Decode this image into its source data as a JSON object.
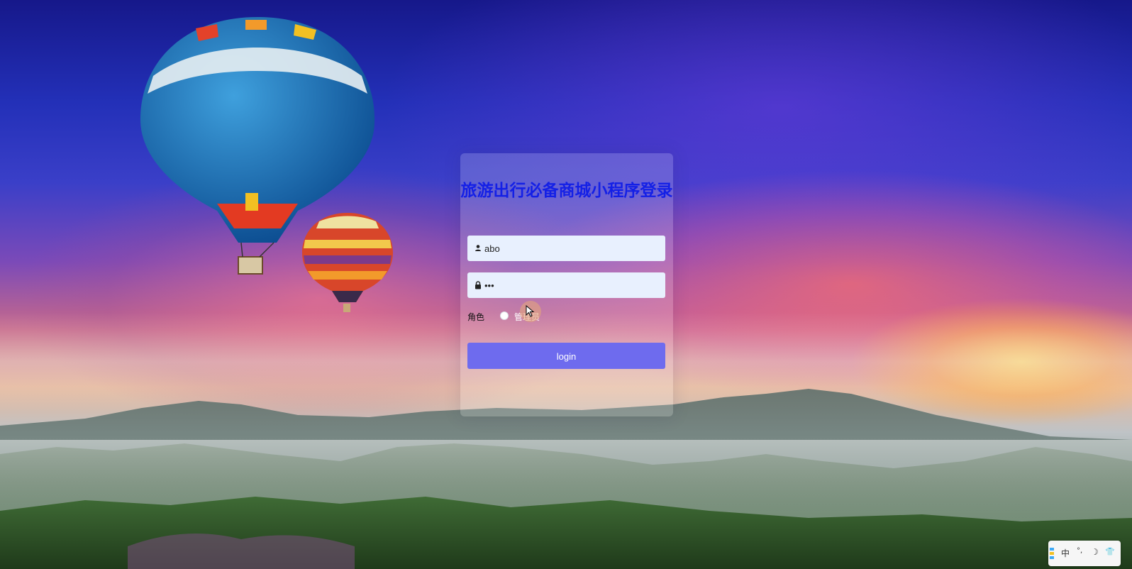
{
  "login": {
    "title": "旅游出行必备商城小程序登录",
    "username_value": "abo",
    "password_value": "•••",
    "role_label": "角色",
    "role_option": "管理员",
    "login_button": "login"
  },
  "ime_toolbar": {
    "lang": "中",
    "punct": "°,",
    "moon": "☽",
    "skin": "👕"
  },
  "colors": {
    "title": "#1420e6",
    "button": "#6e6bee",
    "input_bg": "#e8f0fe"
  }
}
